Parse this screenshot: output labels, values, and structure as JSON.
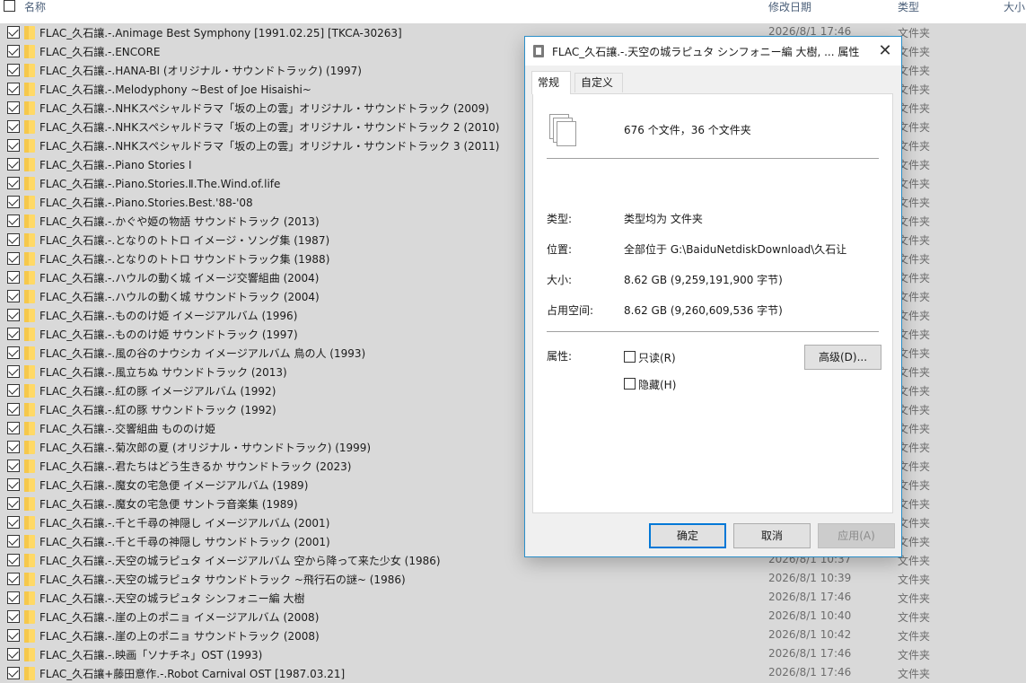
{
  "header": {
    "name": "名称",
    "date": "修改日期",
    "type": "类型",
    "size": "大小"
  },
  "rows": [
    {
      "name": "FLAC_久石讓.-.Animage Best Symphony [1991.02.25] [TKCA-30263]",
      "date": "2026/8/1 17:46",
      "type": "文件夹"
    },
    {
      "name": "FLAC_久石讓.-.ENCORE",
      "date": "",
      "type": "文件夹"
    },
    {
      "name": "FLAC_久石讓.-.HANA-BI (オリジナル・サウンドトラック) (1997)",
      "date": "",
      "type": "文件夹"
    },
    {
      "name": "FLAC_久石讓.-.Melodyphony ~Best of Joe Hisaishi~",
      "date": "",
      "type": "文件夹"
    },
    {
      "name": "FLAC_久石讓.-.NHKスペシャルドラマ「坂の上の雲」オリジナル・サウンドトラック (2009)",
      "date": "",
      "type": "文件夹"
    },
    {
      "name": "FLAC_久石讓.-.NHKスペシャルドラマ「坂の上の雲」オリジナル・サウンドトラック 2 (2010)",
      "date": "",
      "type": "文件夹"
    },
    {
      "name": "FLAC_久石讓.-.NHKスペシャルドラマ「坂の上の雲」オリジナル・サウンドトラック 3 (2011)",
      "date": "",
      "type": "文件夹"
    },
    {
      "name": "FLAC_久石讓.-.Piano Stories I",
      "date": "",
      "type": "文件夹"
    },
    {
      "name": "FLAC_久石讓.-.Piano.Stories.Ⅱ.The.Wind.of.life",
      "date": "",
      "type": "文件夹"
    },
    {
      "name": "FLAC_久石讓.-.Piano.Stories.Best.'88-'08",
      "date": "",
      "type": "文件夹"
    },
    {
      "name": "FLAC_久石讓.-.かぐや姫の物語 サウンドトラック (2013)",
      "date": "",
      "type": "文件夹"
    },
    {
      "name": "FLAC_久石讓.-.となりのトトロ イメージ・ソング集 (1987)",
      "date": "",
      "type": "文件夹"
    },
    {
      "name": "FLAC_久石讓.-.となりのトトロ サウンドトラック集 (1988)",
      "date": "",
      "type": "文件夹"
    },
    {
      "name": "FLAC_久石讓.-.ハウルの動く城 イメージ交響組曲 (2004)",
      "date": "",
      "type": "文件夹"
    },
    {
      "name": "FLAC_久石讓.-.ハウルの動く城 サウンドトラック (2004)",
      "date": "",
      "type": "文件夹"
    },
    {
      "name": "FLAC_久石讓.-.もののけ姫 イメージアルバム (1996)",
      "date": "",
      "type": "文件夹"
    },
    {
      "name": "FLAC_久石讓.-.もののけ姫 サウンドトラック (1997)",
      "date": "",
      "type": "文件夹"
    },
    {
      "name": "FLAC_久石讓.-.風の谷のナウシカ イメージアルバム 鳥の人 (1993)",
      "date": "",
      "type": "文件夹"
    },
    {
      "name": "FLAC_久石讓.-.風立ちぬ サウンドトラック (2013)",
      "date": "",
      "type": "文件夹"
    },
    {
      "name": "FLAC_久石讓.-.紅の豚 イメージアルバム (1992)",
      "date": "",
      "type": "文件夹"
    },
    {
      "name": "FLAC_久石讓.-.紅の豚 サウンドトラック (1992)",
      "date": "",
      "type": "文件夹"
    },
    {
      "name": "FLAC_久石讓.-.交響組曲 もののけ姫",
      "date": "",
      "type": "文件夹"
    },
    {
      "name": "FLAC_久石讓.-.菊次郎の夏 (オリジナル・サウンドトラック) (1999)",
      "date": "",
      "type": "文件夹"
    },
    {
      "name": "FLAC_久石讓.-.君たちはどう生きるか サウンドトラック (2023)",
      "date": "",
      "type": "文件夹"
    },
    {
      "name": "FLAC_久石讓.-.魔女の宅急便 イメージアルバム (1989)",
      "date": "",
      "type": "文件夹"
    },
    {
      "name": "FLAC_久石讓.-.魔女の宅急便 サントラ音楽集 (1989)",
      "date": "",
      "type": "文件夹"
    },
    {
      "name": "FLAC_久石讓.-.千と千尋の神隠し イメージアルバム (2001)",
      "date": "",
      "type": "文件夹"
    },
    {
      "name": "FLAC_久石讓.-.千と千尋の神隠し サウンドトラック (2001)",
      "date": "",
      "type": "文件夹"
    },
    {
      "name": "FLAC_久石讓.-.天空の城ラピュタ イメージアルバム 空から降って来た少女 (1986)",
      "date": "2026/8/1 10:37",
      "type": "文件夹"
    },
    {
      "name": "FLAC_久石讓.-.天空の城ラピュタ サウンドトラック ~飛行石の謎~ (1986)",
      "date": "2026/8/1 10:39",
      "type": "文件夹"
    },
    {
      "name": "FLAC_久石讓.-.天空の城ラピュタ シンフォニー編 大樹",
      "date": "2026/8/1 17:46",
      "type": "文件夹"
    },
    {
      "name": "FLAC_久石讓.-.崖の上のポニョ イメージアルバム (2008)",
      "date": "2026/8/1 10:40",
      "type": "文件夹"
    },
    {
      "name": "FLAC_久石讓.-.崖の上のポニョ サウンドトラック (2008)",
      "date": "2026/8/1 10:42",
      "type": "文件夹"
    },
    {
      "name": "FLAC_久石讓.-.映画「ソナチネ」OST (1993)",
      "date": "2026/8/1 17:46",
      "type": "文件夹"
    },
    {
      "name": "FLAC_久石讓+藤田意作.-.Robot Carnival OST [1987.03.21]",
      "date": "2026/8/1 17:46",
      "type": "文件夹"
    }
  ],
  "dialog": {
    "title": "FLAC_久石讓.-.天空の城ラピュタ シンフォニー編 大樹, ... 属性",
    "close": "✕",
    "tabs": [
      "常规",
      "自定义"
    ],
    "summary": "676 个文件，36 个文件夹",
    "type_label": "类型:",
    "type_value": "类型均为 文件夹",
    "location_label": "位置:",
    "location_value": "全部位于 G:\\BaiduNetdiskDownload\\久石让",
    "size_label": "大小:",
    "size_value": "8.62 GB (9,259,191,900 字节)",
    "disk_label": "占用空间:",
    "disk_value": "8.62 GB (9,260,609,536 字节)",
    "attr_label": "属性:",
    "readonly_label": "只读(R)",
    "hidden_label": "隐藏(H)",
    "advanced_label": "高级(D)...",
    "ok_label": "确定",
    "cancel_label": "取消",
    "apply_label": "应用(A)"
  },
  "colors": {
    "selection_row": "#d9d9d9",
    "dialog_border": "#2b8fc9",
    "primary_button_border": "#0078d7",
    "folder_yellow": "#ffd966"
  }
}
